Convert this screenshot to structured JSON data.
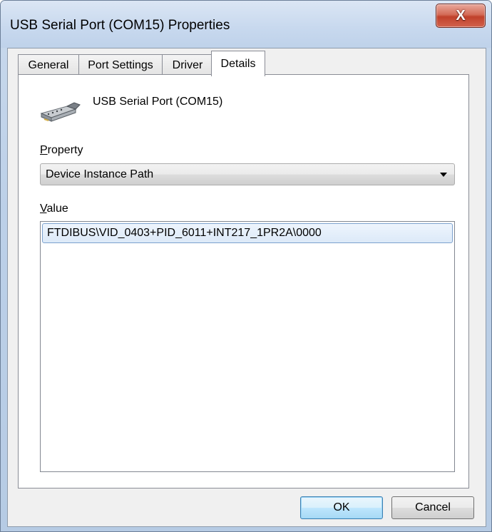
{
  "window": {
    "title": "USB Serial Port (COM15) Properties",
    "close_glyph": "X"
  },
  "tabs": [
    {
      "label": "General"
    },
    {
      "label": "Port Settings"
    },
    {
      "label": "Driver"
    },
    {
      "label": "Details",
      "active": true
    }
  ],
  "details": {
    "device_name": "USB Serial Port (COM15)",
    "device_icon": "serial-port-connector-icon",
    "property_label_accel": "P",
    "property_label_rest": "roperty",
    "property_selected": "Device Instance Path",
    "value_label_accel": "V",
    "value_label_rest": "alue",
    "values": [
      "FTDIBUS\\VID_0403+PID_6011+INT217_1PR2A\\0000"
    ]
  },
  "buttons": {
    "ok": "OK",
    "cancel": "Cancel"
  }
}
